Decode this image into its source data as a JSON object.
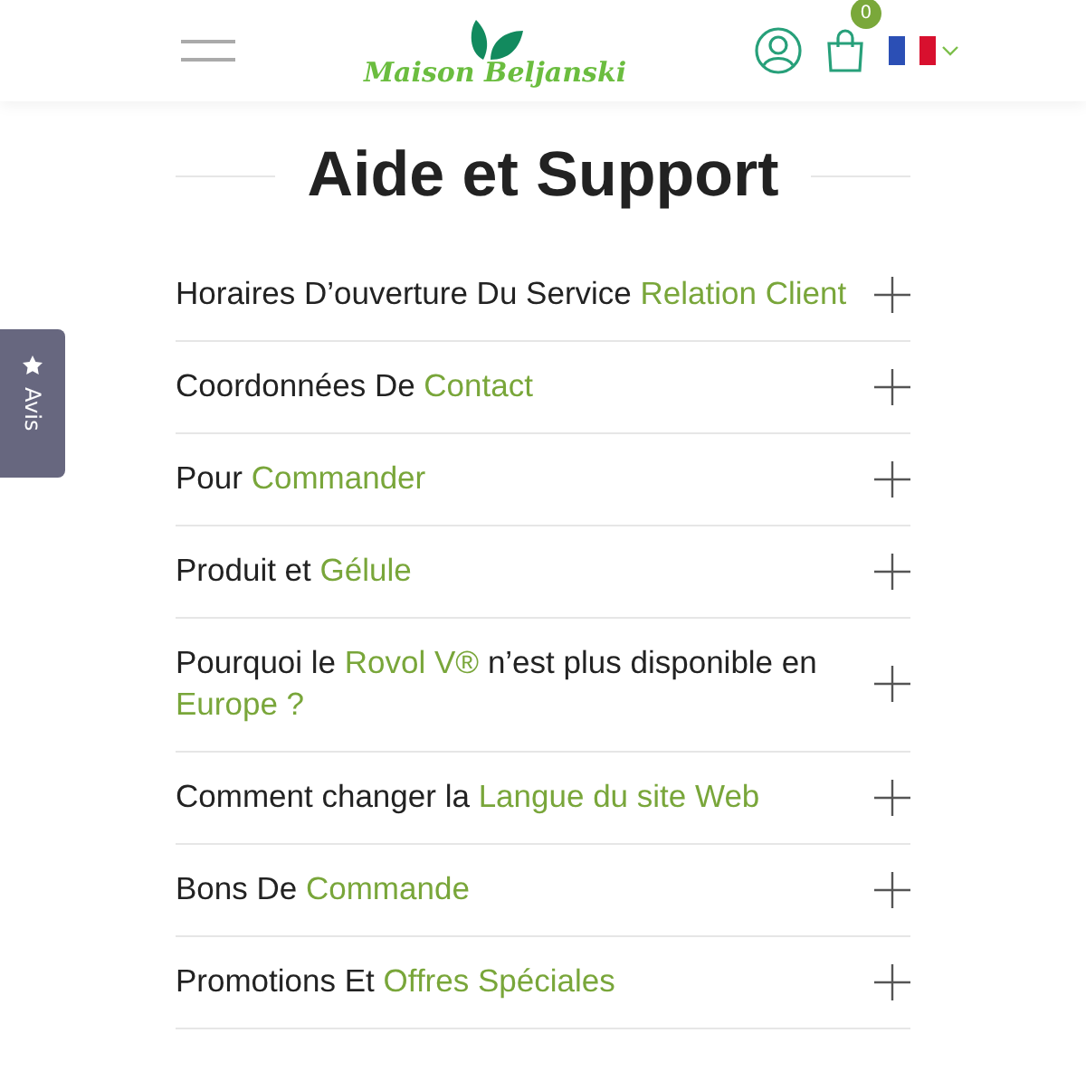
{
  "header": {
    "brand": "Maison Beljanski",
    "cart_count": "0"
  },
  "side_tab": {
    "label": "Avis"
  },
  "title": "Aide et Support",
  "faq": [
    {
      "parts": [
        {
          "text": "Horaires D’ouverture Du Service ",
          "accent": false
        },
        {
          "text": "Relation Client",
          "accent": true
        }
      ],
      "expanded": false
    },
    {
      "parts": [
        {
          "text": "Coordonnées De ",
          "accent": false
        },
        {
          "text": "Contact",
          "accent": true
        }
      ],
      "expanded": false
    },
    {
      "parts": [
        {
          "text": "Pour ",
          "accent": false
        },
        {
          "text": "Commander",
          "accent": true
        }
      ],
      "expanded": false
    },
    {
      "parts": [
        {
          "text": "Produit et ",
          "accent": false
        },
        {
          "text": "Gélule",
          "accent": true
        }
      ],
      "expanded": false
    },
    {
      "parts": [
        {
          "text": "Pourquoi le ",
          "accent": false
        },
        {
          "text": "Rovol V®",
          "accent": true
        },
        {
          "text": " n’est plus disponible en ",
          "accent": false
        },
        {
          "text": "Europe ?",
          "accent": true
        }
      ],
      "expanded": false
    },
    {
      "parts": [
        {
          "text": "Comment changer la ",
          "accent": false
        },
        {
          "text": "Langue du site Web",
          "accent": true
        }
      ],
      "expanded": false
    },
    {
      "parts": [
        {
          "text": "Bons De ",
          "accent": false
        },
        {
          "text": "Commande",
          "accent": true
        }
      ],
      "expanded": false
    },
    {
      "parts": [
        {
          "text": "Promotions Et ",
          "accent": false
        },
        {
          "text": "Offres Spéciales",
          "accent": true
        }
      ],
      "expanded": false
    }
  ]
}
